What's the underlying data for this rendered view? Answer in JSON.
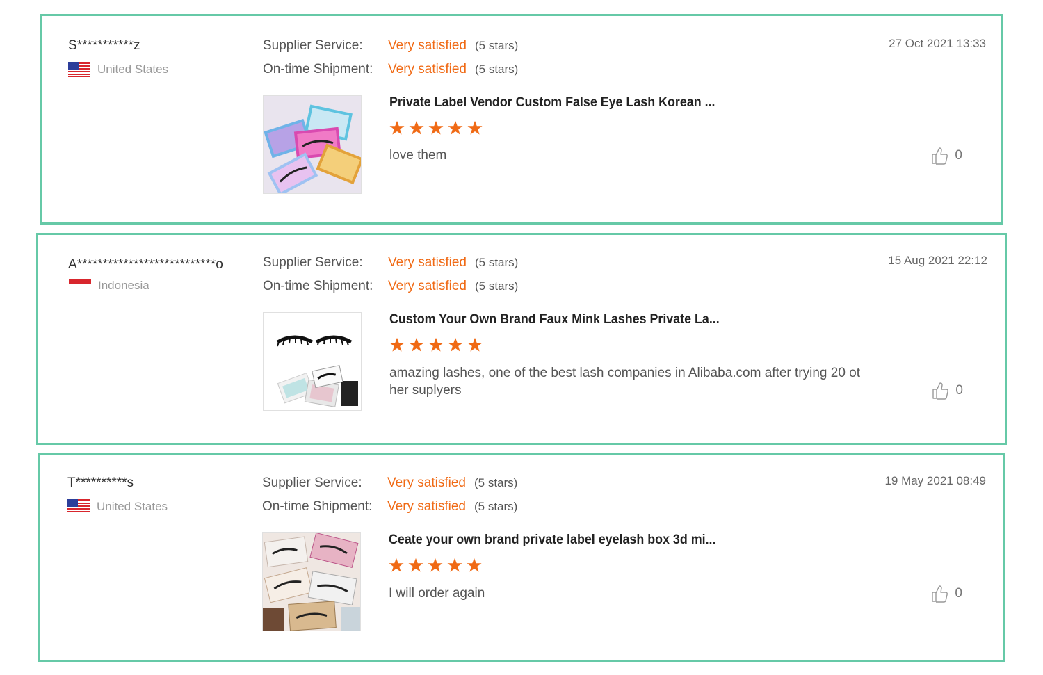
{
  "colors": {
    "border": "#66c9a7",
    "accent": "#f06a15",
    "star": "#f06a15"
  },
  "reviews": [
    {
      "buyer": "S***********z",
      "country": "United States",
      "flag_icon": "us-flag-icon",
      "date": "27 Oct 2021 13:33",
      "supplier_service_label": "Supplier Service:",
      "supplier_service_value": "Very satisfied",
      "supplier_service_stars": "(5 stars)",
      "shipment_label": "On-time Shipment:",
      "shipment_value": "Very satisfied",
      "shipment_stars": "(5 stars)",
      "product_title": "Private Label Vendor Custom False Eye Lash Korean ...",
      "rating": 5,
      "comment": "love them",
      "likes": "0"
    },
    {
      "buyer": "A***************************o",
      "country": "Indonesia",
      "flag_icon": "indonesia-flag-icon",
      "date": "15 Aug 2021 22:12",
      "supplier_service_label": "Supplier Service:",
      "supplier_service_value": "Very satisfied",
      "supplier_service_stars": "(5 stars)",
      "shipment_label": "On-time Shipment:",
      "shipment_value": "Very satisfied",
      "shipment_stars": "(5 stars)",
      "product_title": "Custom Your Own Brand Faux Mink Lashes Private La...",
      "rating": 5,
      "comment": "amazing lashes, one of the best lash companies in Alibaba.com after trying 20 ot her suplyers",
      "likes": "0"
    },
    {
      "buyer": "T**********s",
      "country": "United States",
      "flag_icon": "us-flag-icon",
      "date": "19 May 2021 08:49",
      "supplier_service_label": "Supplier Service:",
      "supplier_service_value": "Very satisfied",
      "supplier_service_stars": "(5 stars)",
      "shipment_label": "On-time Shipment:",
      "shipment_value": "Very satisfied",
      "shipment_stars": "(5 stars)",
      "product_title": "Ceate your own brand private label eyelash box 3d mi...",
      "rating": 5,
      "comment": "I will order again",
      "likes": "0"
    }
  ]
}
